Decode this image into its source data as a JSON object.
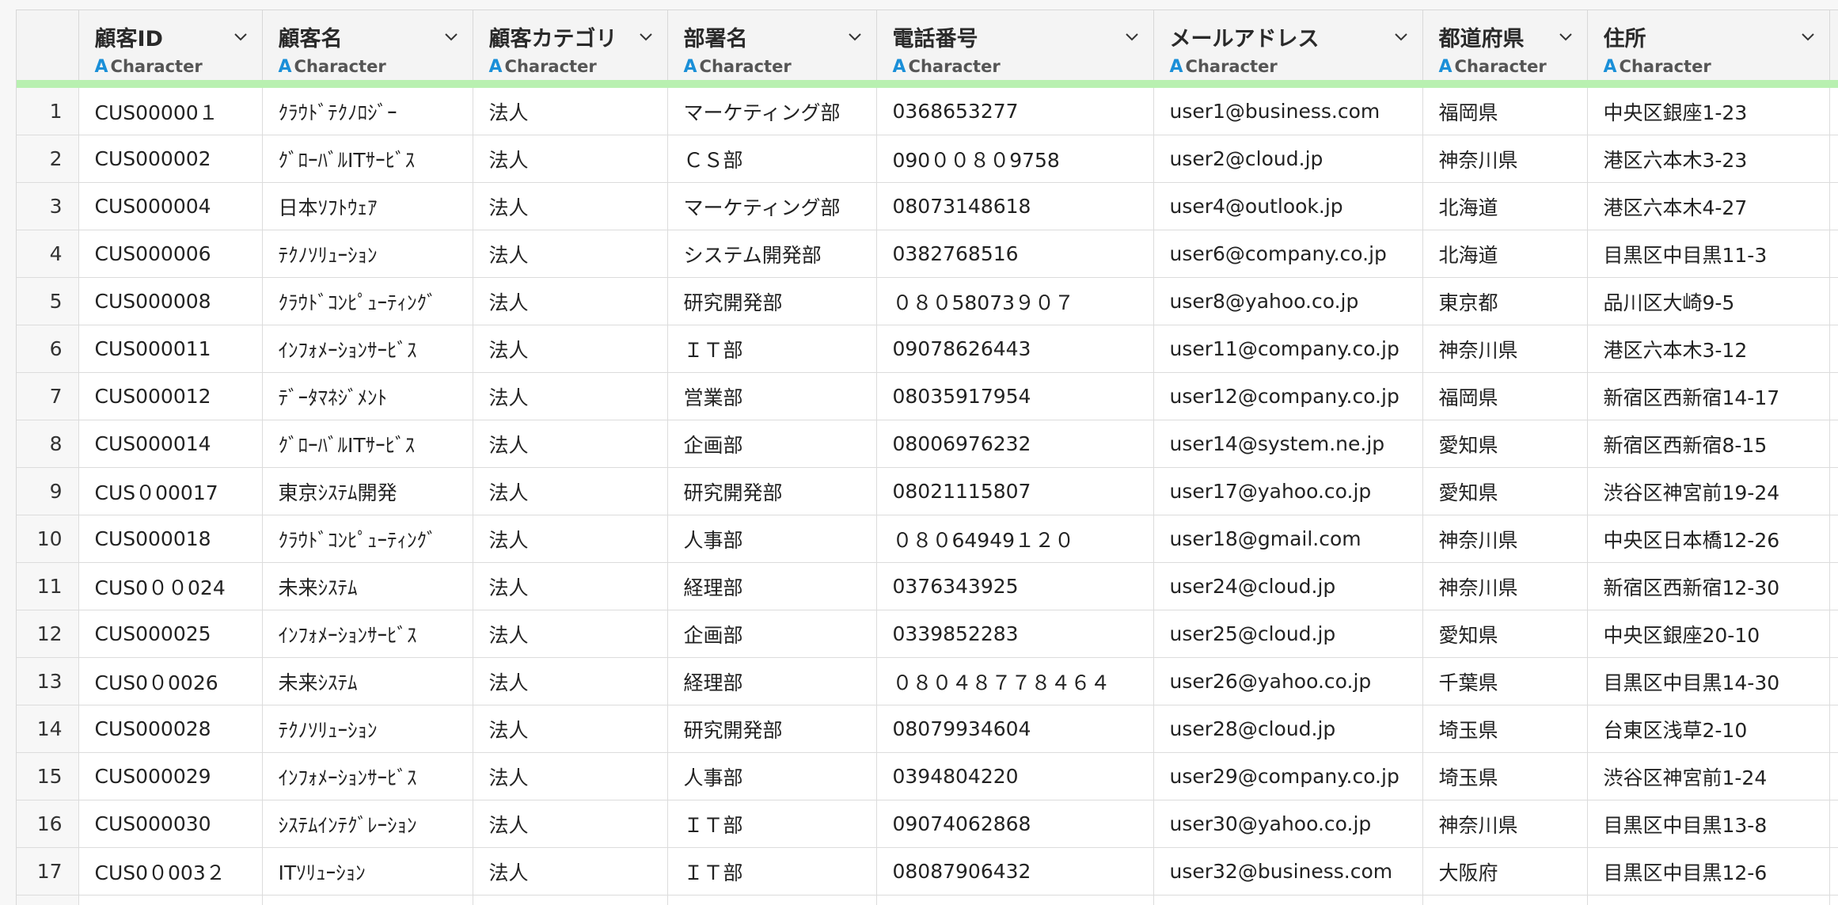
{
  "columns": [
    {
      "name": "顧客ID",
      "type": "Character"
    },
    {
      "name": "顧客名",
      "type": "Character"
    },
    {
      "name": "顧客カテゴリ",
      "type": "Character"
    },
    {
      "name": "部署名",
      "type": "Character"
    },
    {
      "name": "電話番号",
      "type": "Character"
    },
    {
      "name": "メールアドレス",
      "type": "Character"
    },
    {
      "name": "都道府県",
      "type": "Character"
    },
    {
      "name": "住所",
      "type": "Character"
    }
  ],
  "type_icon_glyph": "A",
  "accent_bar_color": "#b8f0b0",
  "type_icon_color": "#1a8fd8",
  "rows": [
    {
      "idx": "1",
      "cells": [
        "CUS00000１",
        "ｸﾗｳﾄﾞﾃｸﾉﾛｼﾞｰ",
        "法人",
        "マーケティング部",
        "0368653277",
        "user1@business.com",
        "福岡県",
        "中央区銀座1-23"
      ]
    },
    {
      "idx": "2",
      "cells": [
        "CUS000002",
        "ｸﾞﾛｰﾊﾞﾙITｻｰﾋﾞｽ",
        "法人",
        "ＣＳ部",
        "090００８０9758",
        "user2@cloud.jp",
        "神奈川県",
        "港区六本木3-23"
      ]
    },
    {
      "idx": "3",
      "cells": [
        "CUS000004",
        "日本ｿﾌﾄｳｪｱ",
        "法人",
        "マーケティング部",
        "08073148618",
        "user4@outlook.jp",
        "北海道",
        "港区六本木4-27"
      ]
    },
    {
      "idx": "4",
      "cells": [
        "CUS000006",
        "ﾃｸﾉｿﾘｭｰｼｮﾝ",
        "法人",
        "システム開発部",
        "0382768516",
        "user6@company.co.jp",
        "北海道",
        "目黒区中目黒11-3"
      ]
    },
    {
      "idx": "5",
      "cells": [
        "CUS000008",
        "ｸﾗｳﾄﾞｺﾝﾋﾟｭｰﾃｨﾝｸﾞ",
        "法人",
        "研究開発部",
        "０８０58073９０７",
        "user8@yahoo.co.jp",
        "東京都",
        "品川区大崎9-5"
      ]
    },
    {
      "idx": "6",
      "cells": [
        "CUS000011",
        "ｲﾝﾌｫﾒｰｼｮﾝｻｰﾋﾞｽ",
        "法人",
        "ＩＴ部",
        "09078626443",
        "user11@company.co.jp",
        "神奈川県",
        "港区六本木3-12"
      ]
    },
    {
      "idx": "7",
      "cells": [
        "CUS000012",
        "ﾃﾞｰﾀﾏﾈｼﾞﾒﾝﾄ",
        "法人",
        "営業部",
        "08035917954",
        "user12@company.co.jp",
        "福岡県",
        "新宿区西新宿14-17"
      ]
    },
    {
      "idx": "8",
      "cells": [
        "CUS000014",
        "ｸﾞﾛｰﾊﾞﾙITｻｰﾋﾞｽ",
        "法人",
        "企画部",
        "08006976232",
        "user14@system.ne.jp",
        "愛知県",
        "新宿区西新宿8-15"
      ]
    },
    {
      "idx": "9",
      "cells": [
        "CUS０00017",
        "東京ｼｽﾃﾑ開発",
        "法人",
        "研究開発部",
        "08021115807",
        "user17@yahoo.co.jp",
        "愛知県",
        "渋谷区神宮前19-24"
      ]
    },
    {
      "idx": "10",
      "cells": [
        "CUS000018",
        "ｸﾗｳﾄﾞｺﾝﾋﾟｭｰﾃｨﾝｸﾞ",
        "法人",
        "人事部",
        "０８０64949１２０",
        "user18@gmail.com",
        "神奈川県",
        "中央区日本橋12-26"
      ]
    },
    {
      "idx": "11",
      "cells": [
        "CUS0００024",
        "未来ｼｽﾃﾑ",
        "法人",
        "経理部",
        "0376343925",
        "user24@cloud.jp",
        "神奈川県",
        "新宿区西新宿12-30"
      ]
    },
    {
      "idx": "12",
      "cells": [
        "CUS000025",
        "ｲﾝﾌｫﾒｰｼｮﾝｻｰﾋﾞｽ",
        "法人",
        "企画部",
        "0339852283",
        "user25@cloud.jp",
        "愛知県",
        "中央区銀座20-10"
      ]
    },
    {
      "idx": "13",
      "cells": [
        "CUS0０0026",
        "未来ｼｽﾃﾑ",
        "法人",
        "経理部",
        "０８０４８７７８４６４",
        "user26@yahoo.co.jp",
        "千葉県",
        "目黒区中目黒14-30"
      ]
    },
    {
      "idx": "14",
      "cells": [
        "CUS000028",
        "ﾃｸﾉｿﾘｭｰｼｮﾝ",
        "法人",
        "研究開発部",
        "08079934604",
        "user28@cloud.jp",
        "埼玉県",
        "台東区浅草2-10"
      ]
    },
    {
      "idx": "15",
      "cells": [
        "CUS000029",
        "ｲﾝﾌｫﾒｰｼｮﾝｻｰﾋﾞｽ",
        "法人",
        "人事部",
        "0394804220",
        "user29@company.co.jp",
        "埼玉県",
        "渋谷区神宮前1-24"
      ]
    },
    {
      "idx": "16",
      "cells": [
        "CUS000030",
        "ｼｽﾃﾑｲﾝﾃｸﾞﾚｰｼｮﾝ",
        "法人",
        "ＩＴ部",
        "09074062868",
        "user30@yahoo.co.jp",
        "神奈川県",
        "目黒区中目黒13-8"
      ]
    },
    {
      "idx": "17",
      "cells": [
        "CUS0０003２",
        "ITｿﾘｭｰｼｮﾝ",
        "法人",
        "ＩＴ部",
        "08087906432",
        "user32@business.com",
        "大阪府",
        "目黒区中目黒12-6"
      ]
    },
    {
      "idx": "",
      "cells": [
        "",
        "",
        "",
        "",
        "",
        "",
        "",
        ""
      ]
    }
  ]
}
